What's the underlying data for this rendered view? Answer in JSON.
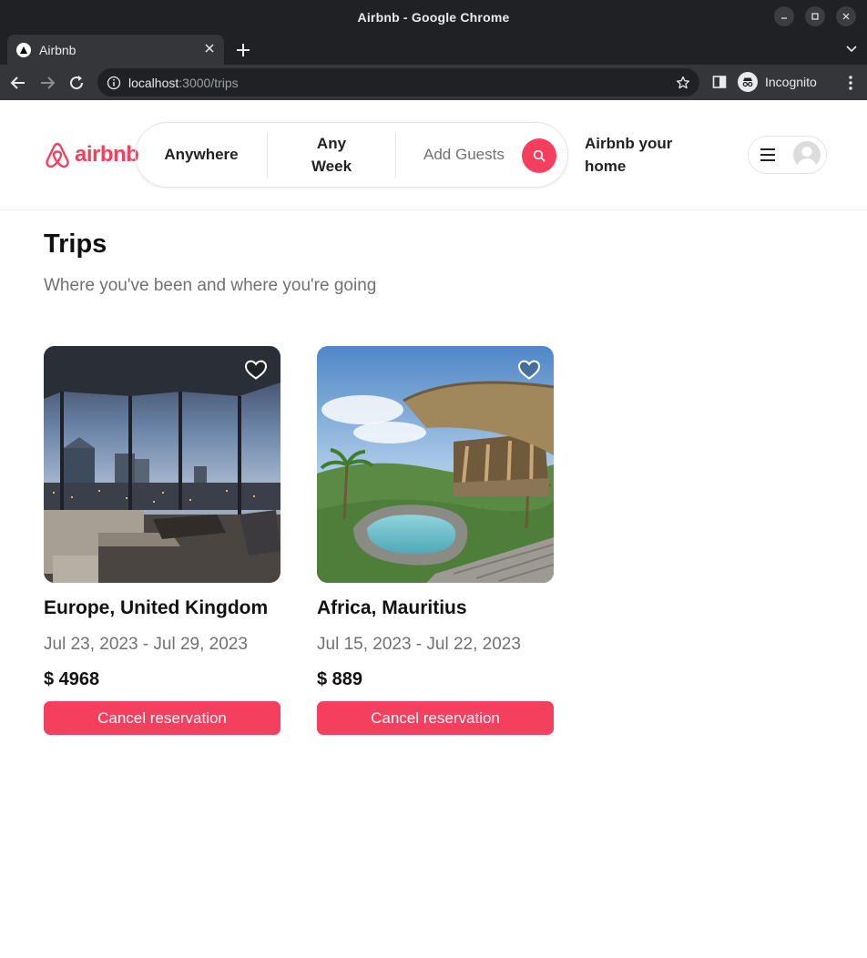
{
  "window": {
    "title": "Airbnb - Google Chrome"
  },
  "browser": {
    "tab_label": "Airbnb",
    "url_host": "localhost",
    "url_path": ":3000/trips",
    "incognito_label": "Incognito"
  },
  "navbar": {
    "logo_text": "airbnb",
    "search": {
      "anywhere": "Anywhere",
      "week_line1": "Any",
      "week_line2": "Week",
      "guests": "Add Guests"
    },
    "host_line1": "Airbnb your",
    "host_line2": "home"
  },
  "page": {
    "title": "Trips",
    "subtitle": "Where you've been and where you're going"
  },
  "trips": [
    {
      "location": "Europe, United Kingdom",
      "dates": "Jul 23, 2023 - Jul 29, 2023",
      "price": "$ 4968",
      "button": "Cancel reservation"
    },
    {
      "location": "Africa, Mauritius",
      "dates": "Jul 15, 2023 - Jul 22, 2023",
      "price": "$ 889",
      "button": "Cancel reservation"
    }
  ],
  "colors": {
    "brand": "#f43f5e",
    "chrome_dark": "#202124",
    "chrome_toolbar": "#35363a",
    "muted_text": "#717171"
  },
  "icons": {
    "tab_favicon": "triangle-icon",
    "search": "search-icon",
    "menu": "menu-icon",
    "avatar": "user-avatar-icon",
    "heart": "heart-icon"
  }
}
